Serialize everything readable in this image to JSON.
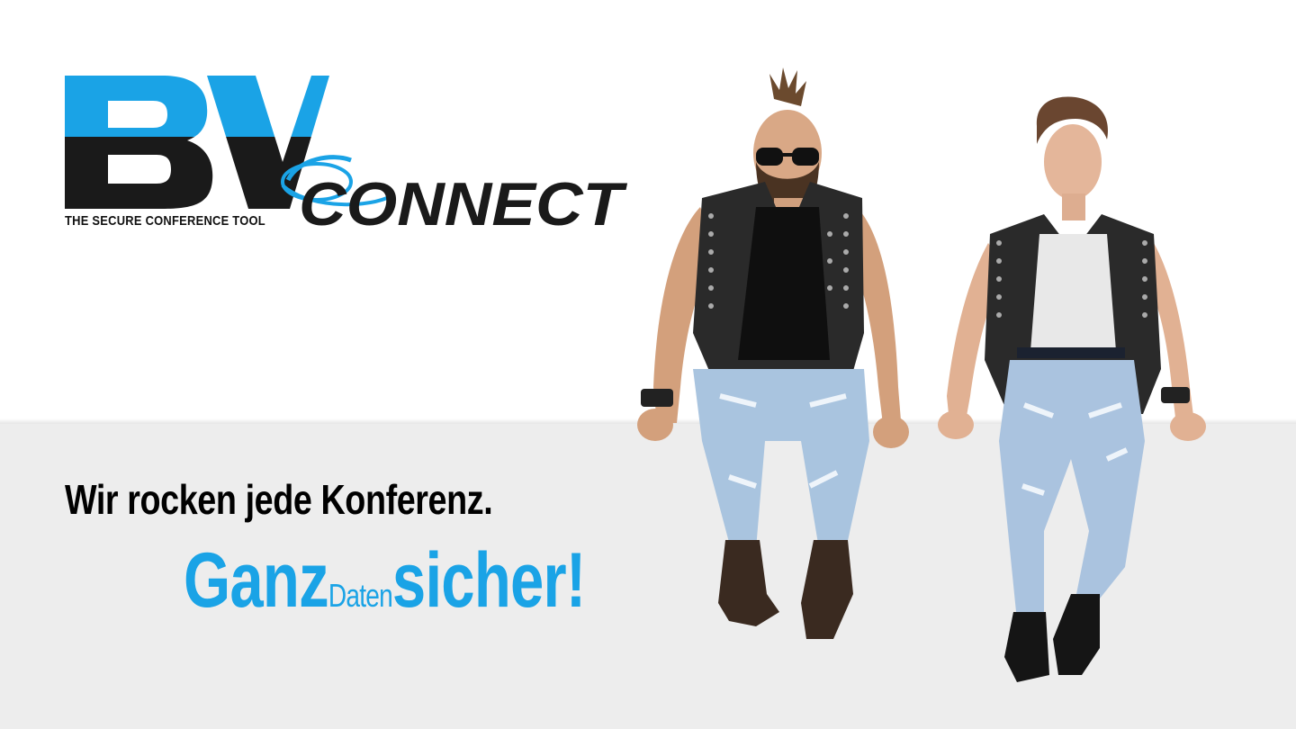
{
  "logo": {
    "letters": "BV",
    "word": "CONNECT",
    "tagline": "THE SECURE CONFERENCE TOOL",
    "colors": {
      "blue": "#1aa3e6",
      "dark": "#1a1a1a"
    }
  },
  "headline": "Wir rocken jede Konferenz.",
  "slogan": {
    "part1": "Ganz",
    "part2": "Daten",
    "part3": "sicher!",
    "color": "#1aa3e6"
  },
  "background": {
    "top": "#ffffff",
    "bottom": "#ededed"
  },
  "image": {
    "subject": "two-punk-models-sitting-on-ledge"
  }
}
